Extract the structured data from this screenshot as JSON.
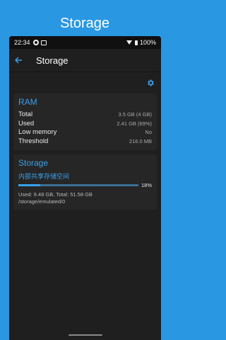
{
  "banner": {
    "title": "Storage"
  },
  "status_bar": {
    "time": "22:34",
    "battery": "100%"
  },
  "toolbar": {
    "title": "Storage"
  },
  "ram": {
    "title": "RAM",
    "rows": [
      {
        "label": "Total",
        "value": "3.5 GB (4 GB)"
      },
      {
        "label": "Used",
        "value": "2.41 GB (69%)"
      },
      {
        "label": "Low memory",
        "value": "No"
      },
      {
        "label": "Threshold",
        "value": "216.0 MB"
      }
    ]
  },
  "storage": {
    "title": "Storage",
    "volume": {
      "name": "内部共享存储空间",
      "percent_label": "18%",
      "used_fraction": 0.18,
      "usage": "Used: 9.48 GB, Total: 51.58 GB",
      "path": "/storage/emulated/0"
    }
  },
  "colors": {
    "accent": "#3aa0ec",
    "banner": "#2a97e3",
    "background": "#1f1f1f",
    "card": "#262626"
  },
  "icons": {
    "back": "arrow-left-icon",
    "settings": "gear-icon"
  }
}
